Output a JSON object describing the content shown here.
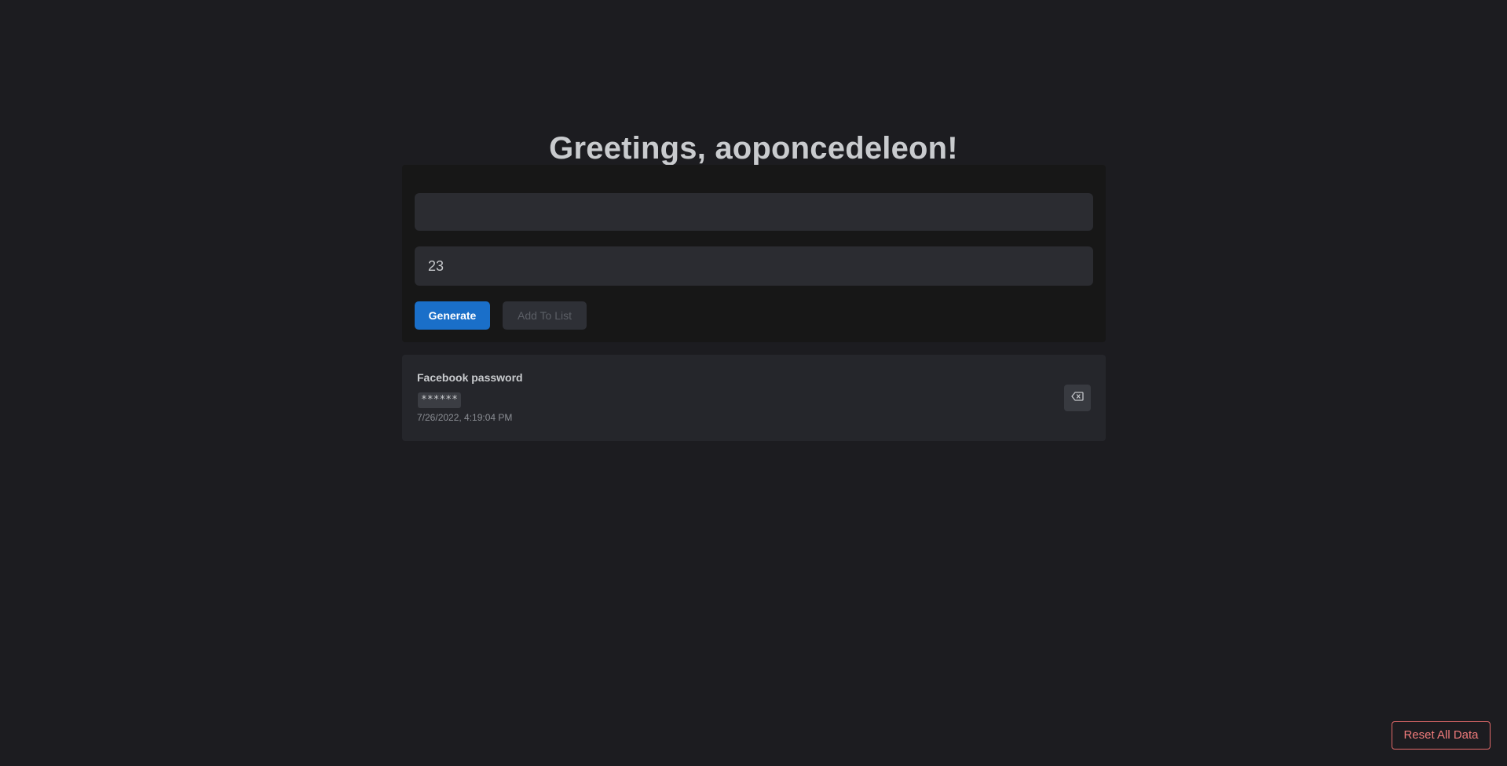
{
  "header": {
    "title": "Greetings, aoponcedeleon!"
  },
  "form": {
    "name_value": "",
    "length_value": "23",
    "generate_label": "Generate",
    "add_label": "Add To List"
  },
  "items": [
    {
      "name": "Facebook password",
      "secret": "******",
      "date": "7/26/2022, 4:19:04 PM",
      "delete_icon": "backspace-delete-icon"
    }
  ],
  "footer": {
    "reset_label": "Reset All Data"
  },
  "colors": {
    "background": "#1c1c20",
    "primary": "#1a6fc9",
    "danger": "#e26a6a"
  }
}
